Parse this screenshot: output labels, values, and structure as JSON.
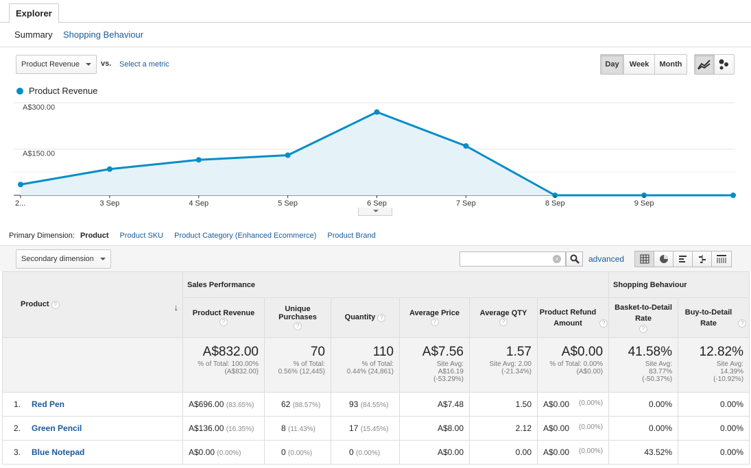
{
  "tabs": {
    "explorer": "Explorer"
  },
  "subtabs": {
    "summary": "Summary",
    "shopping": "Shopping Behaviour"
  },
  "controls": {
    "metric_select": "Product Revenue",
    "vs": "vs.",
    "select_metric": "Select a metric",
    "period": [
      "Day",
      "Week",
      "Month"
    ],
    "period_active": "Day"
  },
  "legend": {
    "series": "Product Revenue",
    "color": "#058dc7"
  },
  "chart_data": {
    "type": "area",
    "x": [
      "2...",
      "3 Sep",
      "4 Sep",
      "5 Sep",
      "6 Sep",
      "7 Sep",
      "8 Sep",
      "9 Sep",
      ""
    ],
    "series": [
      {
        "name": "Product Revenue",
        "values": [
          35,
          85,
          115,
          130,
          270,
          160,
          0,
          0,
          0
        ]
      }
    ],
    "yticks": [
      {
        "value": 300,
        "label": "A$300.00"
      },
      {
        "value": 150,
        "label": "A$150.00"
      }
    ],
    "ylim": [
      0,
      300
    ],
    "grid": true
  },
  "dimensions": {
    "label": "Primary Dimension:",
    "current": "Product",
    "links": [
      "Product SKU",
      "Product Category (Enhanced Ecommerce)",
      "Product Brand"
    ],
    "secondary": "Secondary dimension",
    "advanced": "advanced"
  },
  "table": {
    "groups": {
      "sales": "Sales Performance",
      "shopping": "Shopping Behaviour"
    },
    "product_header": "Product",
    "headers": [
      "Product Revenue",
      "Unique Purchases",
      "Quantity",
      "Average Price",
      "Average QTY",
      "Product Refund Amount",
      "Basket-to-Detail Rate",
      "Buy-to-Detail Rate"
    ],
    "totals": [
      {
        "big": "A$832.00",
        "sub": [
          "% of Total: 100.00%",
          "(A$832.00)"
        ]
      },
      {
        "big": "70",
        "sub": [
          "% of Total:",
          "0.56% (12,445)"
        ]
      },
      {
        "big": "110",
        "sub": [
          "% of Total:",
          "0.44% (24,861)"
        ]
      },
      {
        "big": "A$7.56",
        "sub": [
          "Site Avg:",
          "A$16.19",
          "(-53.29%)"
        ]
      },
      {
        "big": "1.57",
        "sub": [
          "Site Avg: 2.00",
          "(-21.34%)"
        ]
      },
      {
        "big": "A$0.00",
        "sub": [
          "% of Total: 0.00%",
          "(A$0.00)"
        ]
      },
      {
        "big": "41.58%",
        "sub": [
          "Site Avg:",
          "83.77%",
          "(-50.37%)"
        ]
      },
      {
        "big": "12.82%",
        "sub": [
          "Site Avg:",
          "14.39%",
          "(-10.92%)"
        ]
      }
    ],
    "rows": [
      {
        "idx": "1.",
        "name": "Red Pen",
        "revenue": "A$696.00",
        "revenue_pct": "(83.65%)",
        "unique": "62",
        "unique_pct": "(88.57%)",
        "qty": "93",
        "qty_pct": "(84.55%)",
        "avg_price": "A$7.48",
        "avg_qty": "1.50",
        "refund": "A$0.00",
        "refund_pct": "(0.00%)",
        "b2d": "0.00%",
        "buy2d": "0.00%"
      },
      {
        "idx": "2.",
        "name": "Green Pencil",
        "revenue": "A$136.00",
        "revenue_pct": "(16.35%)",
        "unique": "8",
        "unique_pct": "(11.43%)",
        "qty": "17",
        "qty_pct": "(15.45%)",
        "avg_price": "A$8.00",
        "avg_qty": "2.12",
        "refund": "A$0.00",
        "refund_pct": "(0.00%)",
        "b2d": "0.00%",
        "buy2d": "0.00%"
      },
      {
        "idx": "3.",
        "name": "Blue Notepad",
        "revenue": "A$0.00",
        "revenue_pct": "(0.00%)",
        "unique": "0",
        "unique_pct": "(0.00%)",
        "qty": "0",
        "qty_pct": "(0.00%)",
        "avg_price": "A$0.00",
        "avg_qty": "0.00",
        "refund": "A$0.00",
        "refund_pct": "(0.00%)",
        "b2d": "43.52%",
        "buy2d": "0.00%"
      }
    ]
  }
}
